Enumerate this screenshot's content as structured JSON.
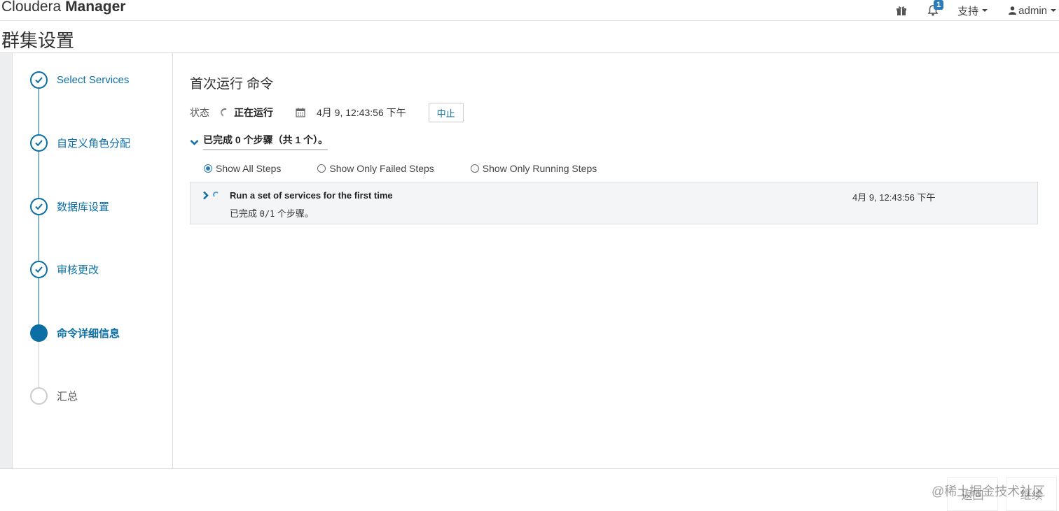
{
  "header": {
    "brand_light": "Cloudera ",
    "brand_bold": "Manager",
    "notification_count": "1",
    "support_label": "支持",
    "user_label": "admin"
  },
  "page": {
    "title": "群集设置"
  },
  "wizard": {
    "steps": [
      {
        "label": "Select Services",
        "state": "done"
      },
      {
        "label": "自定义角色分配",
        "state": "done"
      },
      {
        "label": "数据库设置",
        "state": "done"
      },
      {
        "label": "审核更改",
        "state": "done"
      },
      {
        "label": "命令详细信息",
        "state": "active"
      },
      {
        "label": "汇总",
        "state": "pending"
      }
    ]
  },
  "command": {
    "title": "首次运行 命令",
    "status_label": "状态",
    "status_value": "正在运行",
    "start_time": "4月 9, 12:43:56 下午",
    "abort_label": "中止",
    "progress_summary": "已完成 0 个步骤（共 1 个）。",
    "filters": [
      {
        "label": "Show All Steps",
        "checked": true
      },
      {
        "label": "Show Only Failed Steps",
        "checked": false
      },
      {
        "label": "Show Only Running Steps",
        "checked": false
      }
    ],
    "step": {
      "name": "Run a set of services for the first time",
      "time": "4月 9, 12:43:56 下午",
      "progress_prefix": "已完成 ",
      "progress_count": "0/1",
      "progress_suffix": " 个步骤。"
    }
  },
  "footer": {
    "back_label": "返回",
    "continue_label": "继续",
    "watermark": "@稀土掘金技术社区"
  },
  "colors": {
    "accent": "#0b6fa6",
    "badge": "#2a7bb8"
  }
}
